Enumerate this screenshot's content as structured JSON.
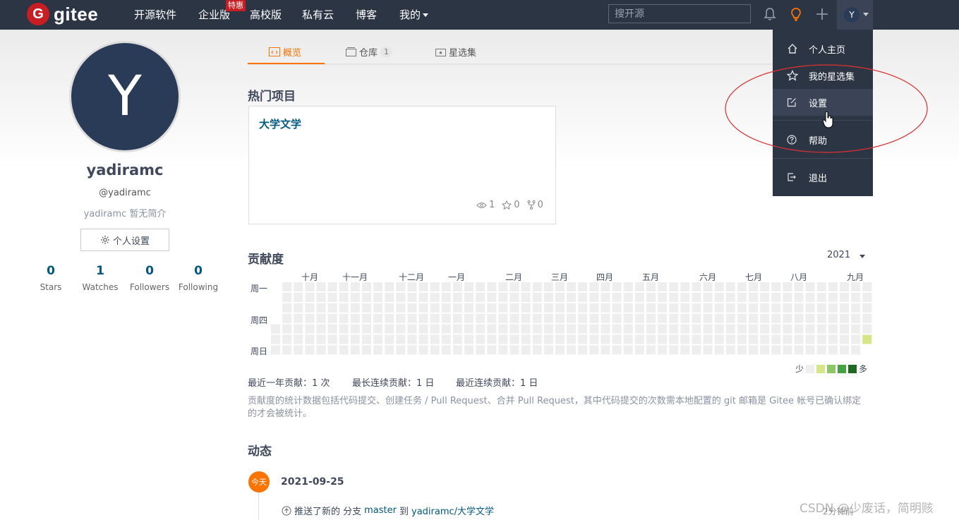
{
  "nav": {
    "logo_mark": "G",
    "logo_text": "gitee",
    "items": [
      "开源软件",
      "企业版",
      "高校版",
      "私有云",
      "博客",
      "我的"
    ],
    "badge": "特惠",
    "search_placeholder": "搜开源",
    "avatar_letter": "Y"
  },
  "profile": {
    "avatar_letter": "Y",
    "name": "yadiramc",
    "handle": "@yadiramc",
    "bio": "yadiramc 暂无简介",
    "settings_button": "个人设置",
    "stats": [
      {
        "num": "0",
        "label": "Stars"
      },
      {
        "num": "1",
        "label": "Watches"
      },
      {
        "num": "0",
        "label": "Followers"
      },
      {
        "num": "0",
        "label": "Following"
      }
    ]
  },
  "tabs": [
    {
      "label": "概览",
      "count": ""
    },
    {
      "label": "仓库",
      "count": "1"
    },
    {
      "label": "星选集",
      "count": ""
    }
  ],
  "hot": {
    "title": "热门项目",
    "project_name": "大学文学",
    "watch": "1",
    "star": "0",
    "fork": "0"
  },
  "contrib": {
    "title": "贡献度",
    "year": "2021",
    "months": [
      "十月",
      "十一月",
      "十二月",
      "一月",
      "二月",
      "三月",
      "四月",
      "五月",
      "六月",
      "七月",
      "八月",
      "九月"
    ],
    "weekdays": [
      "周一",
      "周四",
      "周日"
    ],
    "legend_less": "少",
    "legend_more": "多",
    "colors": [
      "#eeeeee",
      "#d6e685",
      "#8cc665",
      "#44a340",
      "#1e6823"
    ],
    "summary": [
      "最近一年贡献：1 次",
      "最长连续贡献：1 日",
      "最近连续贡献：1 日"
    ],
    "note": "贡献度的统计数据包括代码提交、创建任务 / Pull Request、合并 Pull Request，其中代码提交的次数需本地配置的 git 邮箱是 Gitee 帐号已确认绑定的才会被统计。"
  },
  "activity": {
    "title": "动态",
    "today": "今天",
    "date": "2021-09-25",
    "text_prefix": "推送了新的 分支",
    "branch": "master",
    "text_mid": "到",
    "repo": "yadiramc/大学文学",
    "time": "2分钟前"
  },
  "dropdown": {
    "items": [
      "个人主页",
      "我的星选集",
      "设置",
      "帮助",
      "退出"
    ]
  },
  "watermark": "CSDN @少废话，简明赅"
}
